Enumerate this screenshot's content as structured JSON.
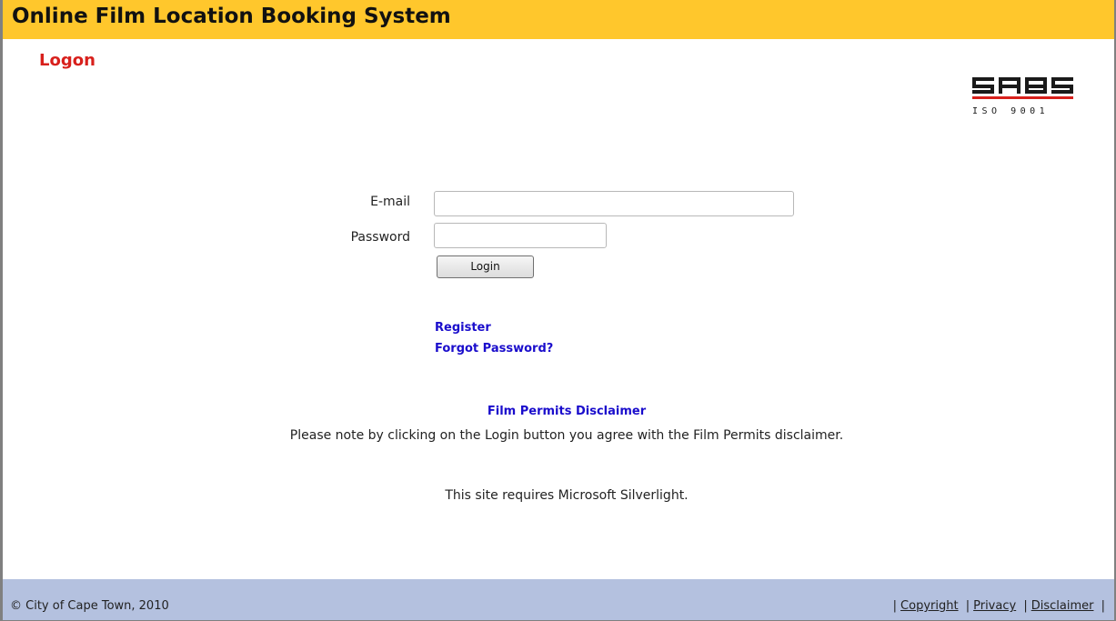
{
  "header": {
    "title": "Online Film Location Booking System"
  },
  "page": {
    "heading": "Logon"
  },
  "logo": {
    "text": "SABS",
    "subtext": "ISO 9001"
  },
  "form": {
    "email_label": "E-mail",
    "email_value": "",
    "password_label": "Password",
    "password_value": "",
    "login_label": "Login"
  },
  "links": {
    "register": "Register",
    "forgot_password": "Forgot Password?"
  },
  "disclaimer": {
    "title": "Film Permits Disclaimer",
    "note": "Please note by clicking on the Login button you agree with the Film Permits disclaimer."
  },
  "requirement": "This site requires Microsoft Silverlight.",
  "footer": {
    "copyright": "© City of Cape Town, 2010",
    "links": [
      "Copyright",
      "Privacy",
      "Disclaimer"
    ]
  },
  "colors": {
    "header_bg": "#ffc72c",
    "footer_bg": "#b4c1df",
    "heading_red": "#d8201c",
    "link_blue": "#1a0dcc"
  }
}
